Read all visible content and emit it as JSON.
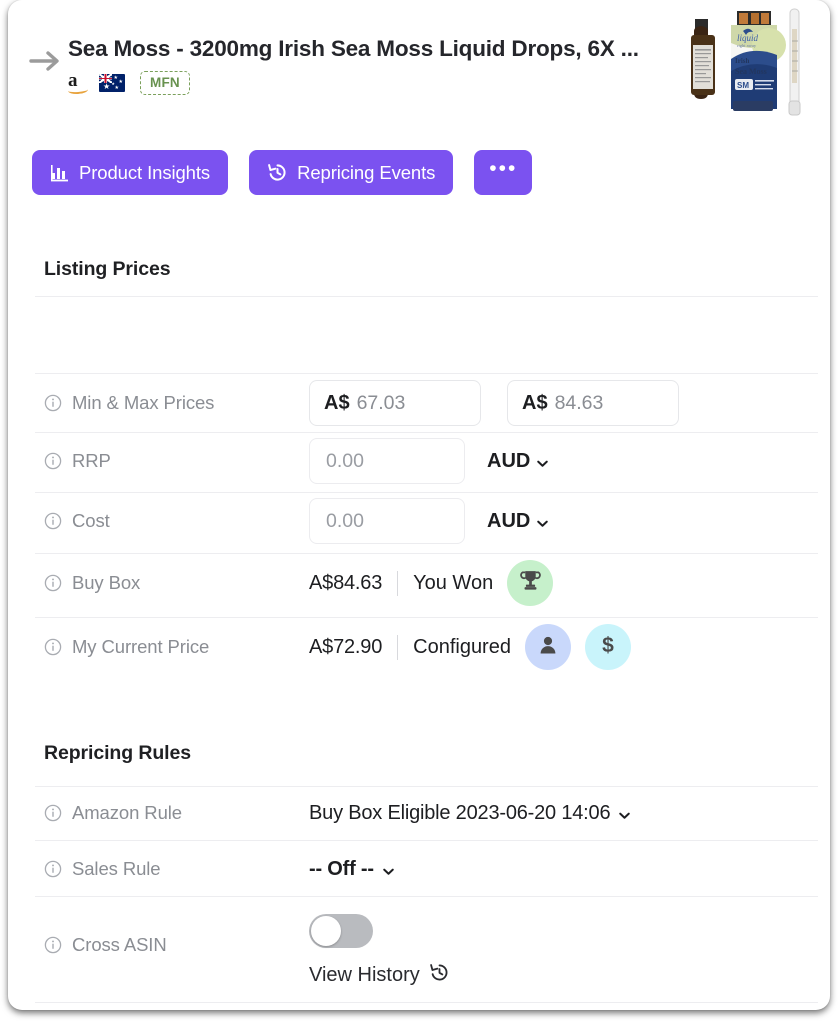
{
  "header": {
    "back_arrow_icon": "arrow-right-icon",
    "title": "Sea Moss - 3200mg Irish Sea Moss Liquid Drops, 6X ...",
    "marketplace_logo": "amazon-logo",
    "marketplace_letter": "a",
    "country_flag": "australia-flag",
    "fulfilment_badge": "MFN",
    "product_image_alt": "sea-moss-bottles"
  },
  "actions": {
    "product_insights": {
      "label": "Product Insights",
      "icon": "bar-chart-icon"
    },
    "repricing_events": {
      "label": "Repricing Events",
      "icon": "history-icon"
    },
    "more": {
      "label": "•••",
      "icon": "ellipsis-icon"
    }
  },
  "listing_prices": {
    "section_title": "Listing Prices",
    "rows": {
      "min_max": {
        "label": "Min & Max Prices",
        "min_currency": "A$",
        "min_value": "67.03",
        "max_currency": "A$",
        "max_value": "84.63"
      },
      "rrp": {
        "label": "RRP",
        "value": "0.00",
        "placeholder": "0.00",
        "currency": "AUD"
      },
      "cost": {
        "label": "Cost",
        "value": "0.00",
        "placeholder": "0.00",
        "currency": "AUD"
      },
      "buy_box": {
        "label": "Buy Box",
        "price": "A$84.63",
        "status": "You Won",
        "badges": [
          "trophy-icon"
        ]
      },
      "my_current_price": {
        "label": "My Current Price",
        "price": "A$72.90",
        "status": "Configured",
        "badges": [
          "person-icon",
          "dollar-icon"
        ]
      }
    }
  },
  "repricing_rules": {
    "section_title": "Repricing Rules",
    "rows": {
      "amazon_rule": {
        "label": "Amazon Rule",
        "value": "Buy Box Eligible 2023-06-20 14:06"
      },
      "sales_rule": {
        "label": "Sales Rule",
        "value": "-- Off --"
      },
      "cross_asin": {
        "label": "Cross ASIN",
        "toggle_state": "off",
        "view_history_label": "View History",
        "view_history_icon": "history-icon"
      }
    }
  },
  "colors": {
    "accent_purple": "#7b52f0",
    "badge_green": "#c6f0cb",
    "badge_blue": "#c9d8fb",
    "badge_cyan": "#c9f4fb",
    "mfn_green": "#68924f",
    "muted_text": "#8a8d93"
  }
}
